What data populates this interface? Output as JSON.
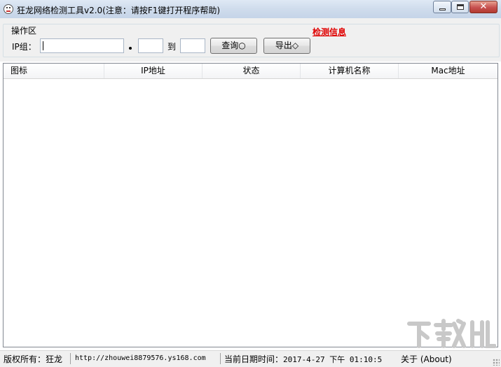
{
  "window": {
    "title": "狂龙网络检测工具v2.0(注意：请按F1键打开程序帮助)",
    "icon": "app-face-icon",
    "close_glyph": "✕"
  },
  "operation_area": {
    "group_label": "操作区",
    "ip_label": "IP组：",
    "ip_value": "",
    "range_start_value": "",
    "to_label": "到",
    "range_end_value": "",
    "query_button": "查询○",
    "export_button": "导出◇",
    "detect_info_link": "检测信息",
    "link_color": "#e00000"
  },
  "table": {
    "columns": [
      "图标",
      "IP地址",
      "状态",
      "计算机名称",
      "Mac地址"
    ],
    "rows": []
  },
  "status_bar": {
    "copyright": "版权所有：狂龙",
    "url": "http://zhouwei8879576.ys168.com",
    "datetime_label": "当前日期时间：",
    "datetime_value": "2017-4-27 下午 01:10:5",
    "about": "关于 (About)"
  },
  "watermark": {
    "logo_name": "xiazaiba-watermark"
  }
}
